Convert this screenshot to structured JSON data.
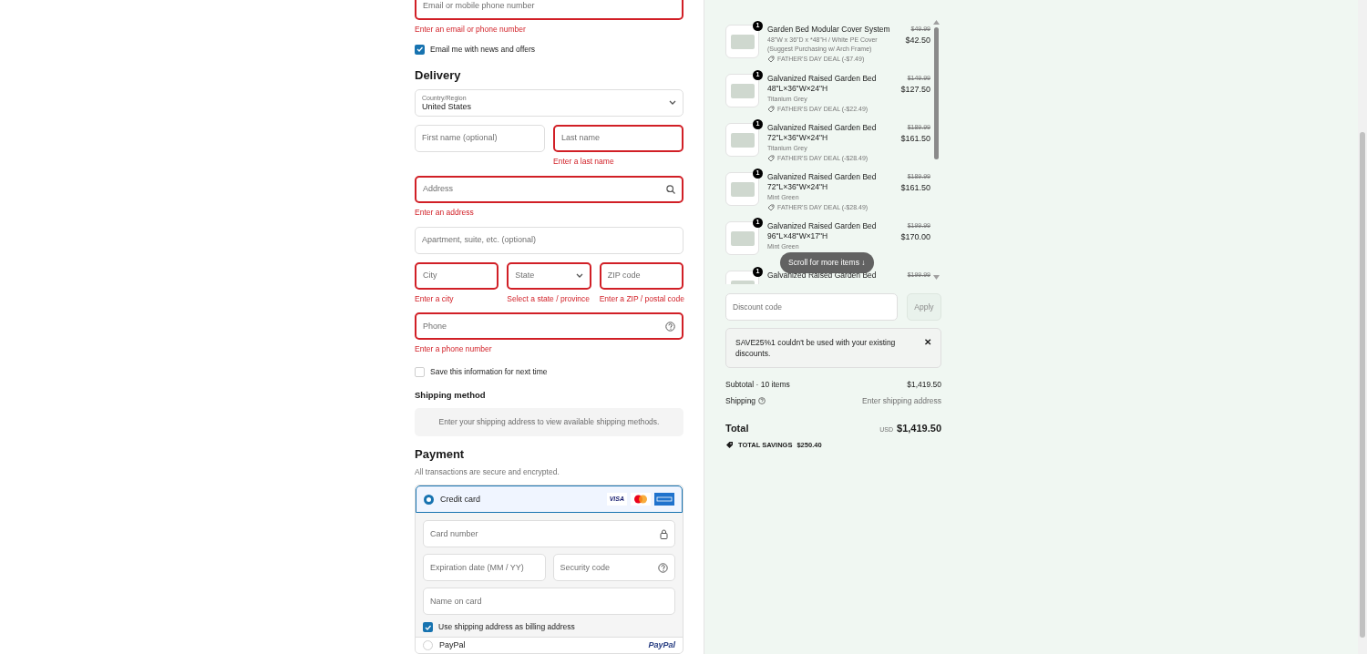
{
  "contact": {
    "email": {
      "placeholder": "Email or mobile phone number",
      "invalid": true,
      "error": "Enter an email or phone number"
    },
    "newsletter": {
      "label": "Email me with news and offers",
      "checked": true
    }
  },
  "delivery": {
    "title": "Delivery",
    "rows": [
      [
        {
          "kind": "select",
          "label": "Country/Region",
          "value": "United States",
          "invalid": false
        }
      ],
      [
        {
          "kind": "text",
          "placeholder": "First name (optional)",
          "invalid": false
        },
        {
          "kind": "text",
          "placeholder": "Last name",
          "invalid": true,
          "error": "Enter a last name"
        }
      ],
      [
        {
          "kind": "search",
          "placeholder": "Address",
          "invalid": true,
          "error": "Enter an address"
        }
      ],
      [
        {
          "kind": "text",
          "placeholder": "Apartment, suite, etc. (optional)",
          "invalid": false
        }
      ],
      [
        {
          "kind": "text",
          "placeholder": "City",
          "invalid": true,
          "error": "Enter a city"
        },
        {
          "kind": "select",
          "placeholder": "State",
          "invalid": true,
          "error": "Select a state / province"
        },
        {
          "kind": "text",
          "placeholder": "ZIP code",
          "invalid": true,
          "error": "Enter a ZIP / postal code"
        }
      ],
      [
        {
          "kind": "help",
          "placeholder": "Phone",
          "invalid": true,
          "error": "Enter a phone number"
        }
      ]
    ],
    "save": {
      "label": "Save this information for next time",
      "checked": false
    }
  },
  "shipping": {
    "title": "Shipping method",
    "notice": "Enter your shipping address to view available shipping methods."
  },
  "payment": {
    "title": "Payment",
    "subtitle": "All transactions are secure and encrypted.",
    "methods": [
      {
        "kind": "card",
        "label": "Credit card",
        "selected": true,
        "brands": [
          {
            "kind": "visa",
            "label": "VISA"
          },
          {
            "kind": "mastercard"
          },
          {
            "kind": "amex"
          }
        ],
        "fields": [
          [
            {
              "kind": "lock",
              "placeholder": "Card number"
            }
          ],
          [
            {
              "kind": "text",
              "placeholder": "Expiration date (MM / YY)"
            },
            {
              "kind": "help",
              "placeholder": "Security code"
            }
          ],
          [
            {
              "kind": "text",
              "placeholder": "Name on card"
            }
          ]
        ],
        "billing": {
          "label": "Use shipping address as billing address",
          "checked": true
        }
      },
      {
        "kind": "paypal",
        "label": "PayPal",
        "selected": false,
        "logo_text": "PayPal"
      }
    ]
  },
  "order": {
    "items": [
      {
        "quantity": "1",
        "title": "Garden Bed Modular Cover System",
        "variant": "48\"W x 36\"D x *48\"H / White PE Cover (Suggest Purchasing w/ Arch Frame)",
        "deal": "FATHER'S DAY DEAL (-$7.49)",
        "old_price": "$49.99",
        "price": "$42.50"
      },
      {
        "quantity": "1",
        "title": "Galvanized Raised Garden Bed 48\"L×36\"W×24\"H",
        "variant": "Titanium Grey",
        "deal": "FATHER'S DAY DEAL (-$22.49)",
        "old_price": "$149.99",
        "price": "$127.50"
      },
      {
        "quantity": "1",
        "title": "Galvanized Raised Garden Bed 72\"L×36\"W×24\"H",
        "variant": "Titanium Grey",
        "deal": "FATHER'S DAY DEAL (-$28.49)",
        "old_price": "$189.99",
        "price": "$161.50"
      },
      {
        "quantity": "1",
        "title": "Galvanized Raised Garden Bed 72\"L×36\"W×24\"H",
        "variant": "Mint Green",
        "deal": "FATHER'S DAY DEAL (-$28.49)",
        "old_price": "$189.99",
        "price": "$161.50"
      },
      {
        "quantity": "1",
        "title": "Galvanized Raised Garden Bed 96\"L×48\"W×17\"H",
        "variant": "Mint Green",
        "old_price": "$199.99",
        "price": "$170.00"
      },
      {
        "quantity": "1",
        "title": "Galvanized Raised Garden Bed",
        "old_price": "$199.99"
      }
    ],
    "scroll_hint": "Scroll for more items ↓",
    "discount": {
      "placeholder": "Discount code",
      "button": "Apply"
    },
    "alert": {
      "text": "SAVE25%1 couldn't be used with your existing discounts.",
      "close": "✕"
    },
    "subtotal": {
      "label": "Subtotal · 10 items",
      "value": "$1,419.50"
    },
    "shipping": {
      "label": "Shipping",
      "value": "Enter shipping address"
    },
    "total": {
      "label": "Total",
      "currency": "USD",
      "value": "$1,419.50"
    },
    "savings": {
      "label": "TOTAL SAVINGS",
      "value": "$250.40"
    }
  }
}
